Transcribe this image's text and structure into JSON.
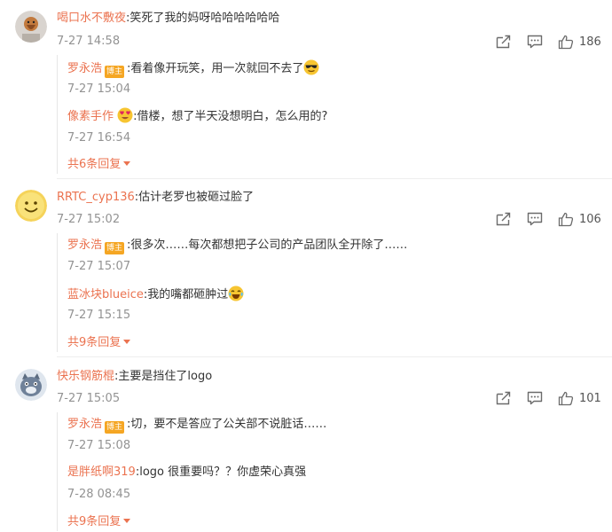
{
  "colors": {
    "username": "#eb7350",
    "time": "#939393",
    "badge": "#f5a623"
  },
  "comments": [
    {
      "user": "喝口水不敷夜",
      "text": ":笑死了我的妈呀哈哈哈哈哈哈",
      "time": "7-27 14:58",
      "likes": "186",
      "replies": [
        {
          "user": "罗永浩",
          "badge": "博主",
          "text": ":看着像开玩笑，用一次就回不去了",
          "emoji": "cool-emoji",
          "time": "7-27 15:04"
        },
        {
          "user": "像素手作",
          "emoji_after_name": "heart-eyes-emoji",
          "text": ":借楼，想了半天没想明白，怎么用的?",
          "time": "7-27 16:54"
        }
      ],
      "more": "共6条回复"
    },
    {
      "user": "RRTC_cyp136",
      "text": ":估计老罗也被砸过脸了",
      "time": "7-27 15:02",
      "likes": "106",
      "replies": [
        {
          "user": "罗永浩",
          "badge": "博主",
          "text": ":很多次……每次都想把子公司的产品团队全开除了……",
          "time": "7-27 15:07"
        },
        {
          "user": "蓝冰块blueice",
          "text": ":我的嘴都砸肿过",
          "emoji": "laugh-tears-emoji",
          "time": "7-27 15:15"
        }
      ],
      "more": "共9条回复"
    },
    {
      "user": "快乐钢筋棍",
      "text": ":主要是挡住了logo",
      "time": "7-27 15:05",
      "likes": "101",
      "replies": [
        {
          "user": "罗永浩",
          "badge": "博主",
          "text": ":切，要不是答应了公关部不说脏话……",
          "time": "7-27 15:08"
        },
        {
          "user": "是胖纸啊319",
          "text": ":logo 很重要吗？？你虚荣心真强",
          "time": "7-28 08:45"
        }
      ],
      "more": "共9条回复"
    }
  ]
}
